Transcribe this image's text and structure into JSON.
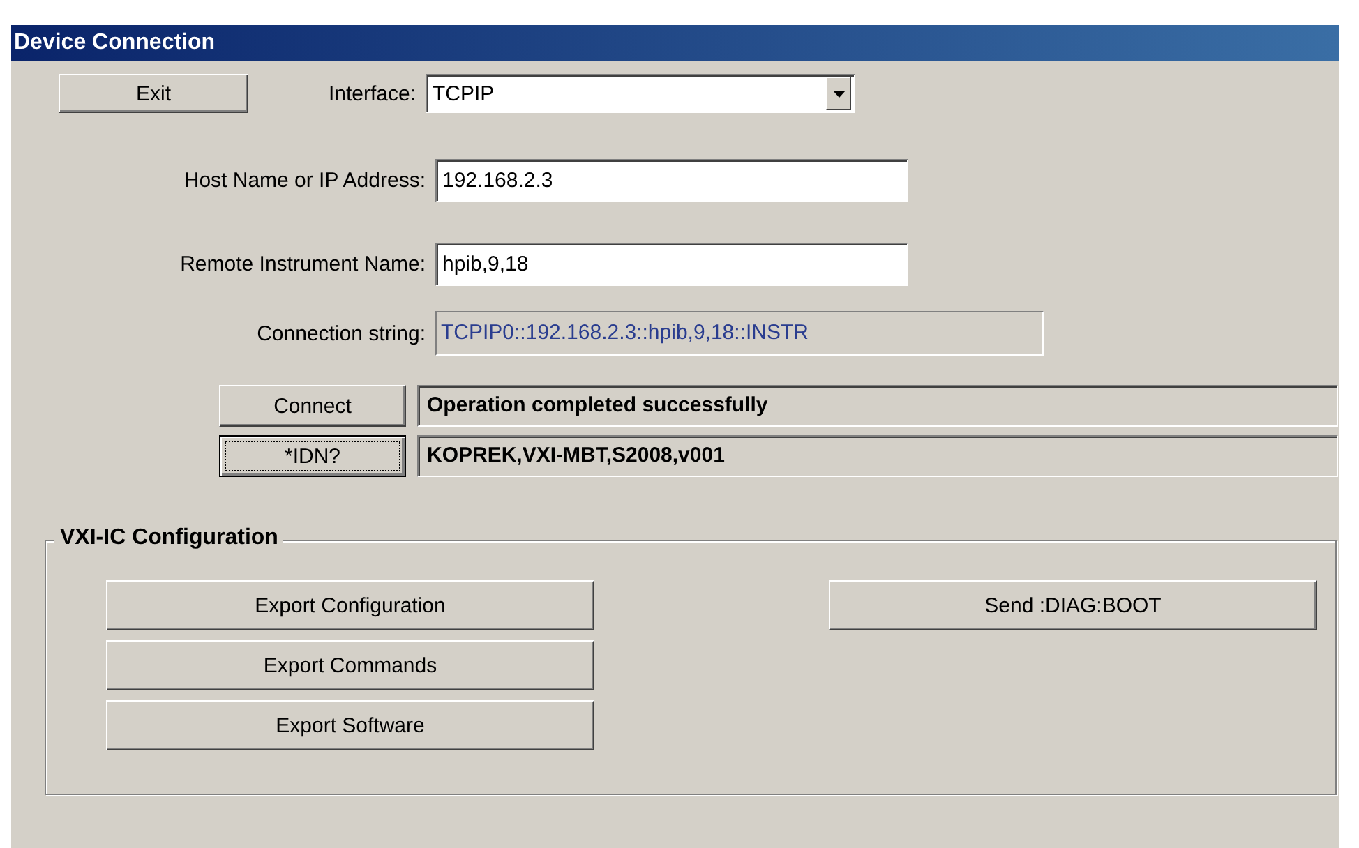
{
  "window": {
    "title": "Device Connection"
  },
  "exit_button": "Exit",
  "interface": {
    "label": "Interface:",
    "value": "TCPIP"
  },
  "host": {
    "label": "Host Name or IP Address:",
    "value": "192.168.2.3"
  },
  "remote": {
    "label": "Remote Instrument Name:",
    "value": "hpib,9,18"
  },
  "connection_string": {
    "label": "Connection string:",
    "value": "TCPIP0::192.168.2.3::hpib,9,18::INSTR"
  },
  "actions": [
    {
      "button": "Connect",
      "result": "Operation completed successfully",
      "focused": false
    },
    {
      "button": "*IDN?",
      "result": "KOPREK,VXI-MBT,S2008,v001",
      "focused": true
    }
  ],
  "group": {
    "title": "VXI-IC Configuration",
    "left_buttons": [
      "Export Configuration",
      "Export Commands",
      "Export Software"
    ],
    "right_button": "Send  :DIAG:BOOT"
  }
}
